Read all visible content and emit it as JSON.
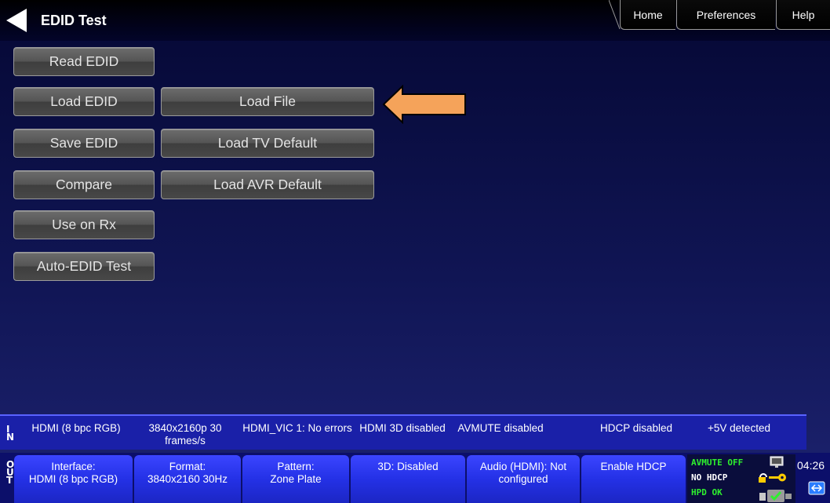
{
  "header": {
    "title": "EDID Test",
    "tabs": {
      "home": "Home",
      "preferences": "Preferences",
      "help": "Help"
    }
  },
  "buttons": {
    "read_edid": "Read EDID",
    "load_edid": "Load EDID",
    "save_edid": "Save EDID",
    "compare": "Compare",
    "use_on_rx": "Use on Rx",
    "auto_edid_test": "Auto-EDID Test",
    "load_file": "Load File",
    "load_tv_default": "Load TV Default",
    "load_avr_default": "Load AVR Default"
  },
  "annotation": {
    "arrow_color": "#f5a35a",
    "arrow_target": "load_file"
  },
  "in_status": {
    "label_lines": [
      "I",
      "N"
    ],
    "cells": [
      "HDMI (8 bpc RGB)",
      "3840x2160p 30 frames/s",
      "HDMI_VIC 1: No errors",
      "HDMI 3D disabled",
      "AVMUTE disabled",
      "HDCP disabled",
      "+5V detected"
    ]
  },
  "out_status": {
    "label_lines": [
      "O",
      "U",
      "T"
    ],
    "buttons": {
      "interface": {
        "line1": "Interface:",
        "line2": "HDMI (8 bpc RGB)"
      },
      "format": {
        "line1": "Format:",
        "line2": "3840x2160 30Hz"
      },
      "pattern": {
        "line1": "Pattern:",
        "line2": "Zone Plate"
      },
      "3d": {
        "line1": "3D: Disabled",
        "line2": ""
      },
      "audio": {
        "line1": "Audio (HDMI): Not",
        "line2": "configured"
      },
      "hdcp": {
        "line1": "Enable HDCP",
        "line2": ""
      }
    },
    "indicators": {
      "avmute": "AVMUTE OFF",
      "hdcp": "NO HDCP",
      "hpd": "HPD OK"
    },
    "clock": "04:26"
  },
  "colors": {
    "background": "#101554",
    "status_bar": "#1a20a8",
    "out_button": "#2431e6",
    "indicator_green": "#2ef02e"
  }
}
